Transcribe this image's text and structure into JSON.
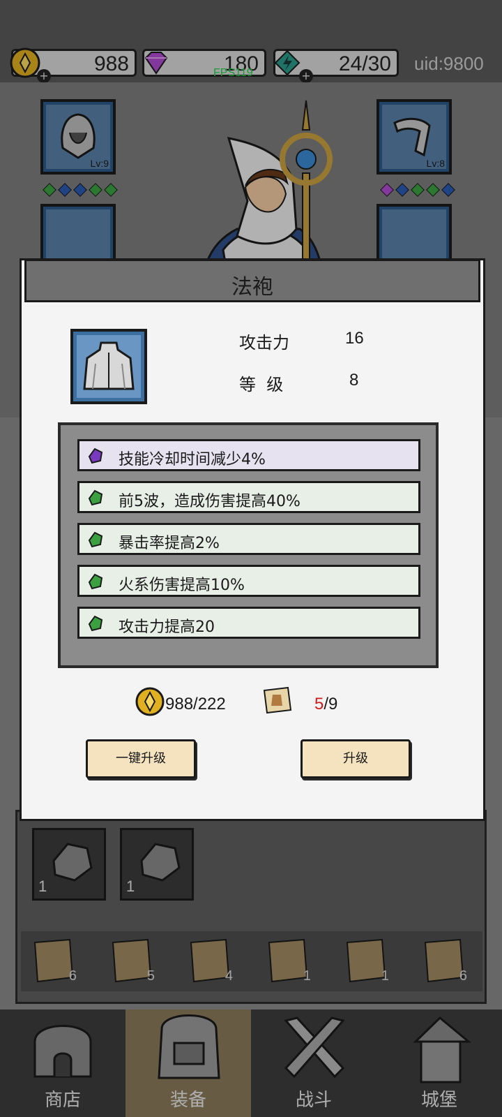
{
  "top_bar": {
    "gold": "988",
    "gems": "180",
    "energy": "24/30",
    "uid": "uid:9800",
    "fps": "FPS119"
  },
  "equip_slots": {
    "helmet_level": "Lv:9",
    "gloves_level": "Lv:8"
  },
  "dialog": {
    "title": "法袍",
    "stats": [
      {
        "label": "攻击力",
        "value": "16"
      },
      {
        "label": "等  级",
        "value": "8"
      }
    ],
    "attributes": [
      {
        "text": "技能冷却时间减少4%",
        "rarity": "purple"
      },
      {
        "text": "前5波，造成伤害提高40%",
        "rarity": "green"
      },
      {
        "text": "暴击率提高2%",
        "rarity": "green"
      },
      {
        "text": "火系伤害提高10%",
        "rarity": "green"
      },
      {
        "text": "攻击力提高20",
        "rarity": "green"
      }
    ],
    "gold_cost": "988/222",
    "scroll_have": "5",
    "scroll_need": "/9",
    "btn_upgrade_all": "一键升级",
    "btn_upgrade": "升级"
  },
  "inventory": {
    "stones": [
      {
        "count": "1"
      },
      {
        "count": "1"
      }
    ],
    "scrolls": [
      {
        "count": "6"
      },
      {
        "count": "5"
      },
      {
        "count": "4"
      },
      {
        "count": "1"
      },
      {
        "count": "1"
      },
      {
        "count": "6"
      }
    ]
  },
  "nav": {
    "shop": "商店",
    "equip": "装备",
    "battle": "战斗",
    "castle": "城堡"
  },
  "colors": {
    "gold": "#e0b020",
    "gem_purple": "#b04ad0",
    "energy_teal": "#2a9a8a",
    "attr_purple": "#7a3ac0",
    "attr_green": "#3aa040",
    "cost_red": "#d11a1a"
  }
}
